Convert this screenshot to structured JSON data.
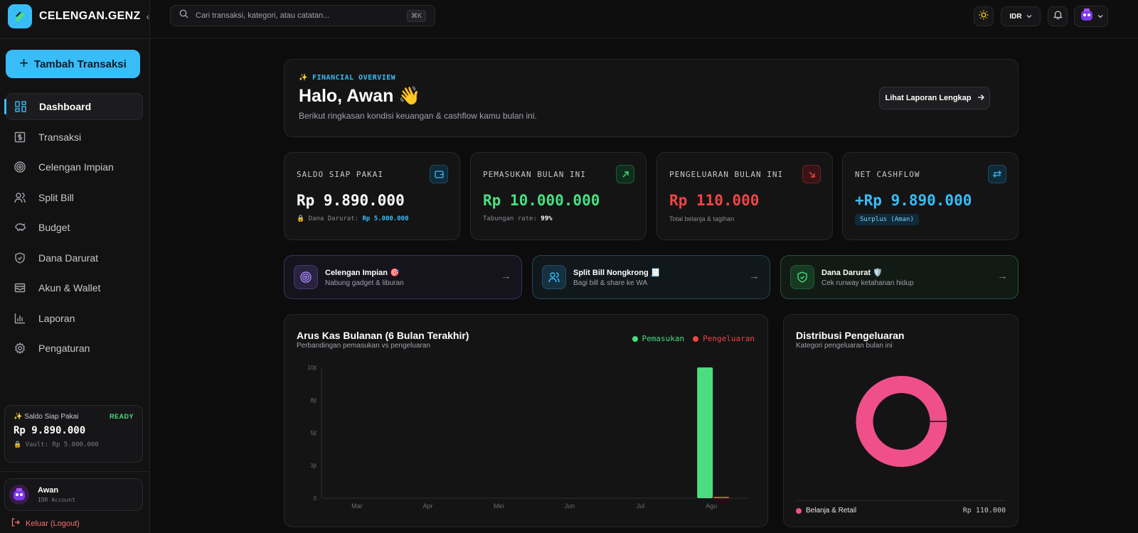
{
  "brand": {
    "name": "CELENGAN.GENZ"
  },
  "sidebar": {
    "add_button": "Tambah Transaksi",
    "items": [
      {
        "label": "Dashboard"
      },
      {
        "label": "Transaksi"
      },
      {
        "label": "Celengan Impian"
      },
      {
        "label": "Split Bill"
      },
      {
        "label": "Budget"
      },
      {
        "label": "Dana Darurat"
      },
      {
        "label": "Akun & Wallet"
      },
      {
        "label": "Laporan"
      },
      {
        "label": "Pengaturan"
      }
    ],
    "balance_card": {
      "title": "Saldo Siap Pakai",
      "status": "READY",
      "amount": "Rp 9.890.000",
      "vault": "Vault: Rp 5.000.000"
    },
    "user": {
      "name": "Awan",
      "account": "IDR Account"
    },
    "logout": "Keluar (Logout)"
  },
  "topbar": {
    "search_placeholder": "Cari transaksi, kategori, atau catatan...",
    "shortcut": "⌘K",
    "currency": "IDR"
  },
  "hero": {
    "tag": "FINANCIAL OVERVIEW",
    "greeting": "Halo, Awan 👋",
    "subtitle": "Berikut ringkasan kondisi keuangan & cashflow kamu bulan ini.",
    "report_button": "Lihat Laporan Lengkap"
  },
  "stats": {
    "saldo": {
      "label": "SALDO SIAP PAKAI",
      "value": "Rp 9.890.000",
      "foot_label": "Dana Darurat:",
      "foot_value": "Rp 5.000.000"
    },
    "pemasukan": {
      "label": "PEMASUKAN BULAN INI",
      "value": "Rp 10.000.000",
      "foot_label": "Tabungan rate:",
      "foot_value": "99%"
    },
    "pengeluaran": {
      "label": "PENGELUARAN BULAN INI",
      "value": "Rp 110.000",
      "foot": "Total belanja & tagihan"
    },
    "net": {
      "label": "NET CASHFLOW",
      "value": "+Rp 9.890.000",
      "badge": "Surplus (Aman)"
    }
  },
  "quick_actions": [
    {
      "title": "Celengan Impian 🎯",
      "subtitle": "Nabung gadget & liburan"
    },
    {
      "title": "Split Bill Nongkrong 🧾",
      "subtitle": "Bagi bill & share ke WA"
    },
    {
      "title": "Dana Darurat 🛡️",
      "subtitle": "Cek runway ketahanan hidup"
    }
  ],
  "colors": {
    "accent": "#38bdf8",
    "income": "#4ade80",
    "expense": "#ef4444",
    "pink": "#f0508a"
  },
  "chart_data": [
    {
      "type": "bar",
      "title": "Arus Kas Bulanan (6 Bulan Terakhir)",
      "subtitle": "Perbandingan pemasukan vs pengeluaran",
      "categories": [
        "Mar",
        "Apr",
        "Mei",
        "Jun",
        "Jul",
        "Agu"
      ],
      "series": [
        {
          "name": "Pemasukan",
          "values": [
            0,
            0,
            0,
            0,
            0,
            10000000
          ],
          "color": "#4ade80"
        },
        {
          "name": "Pengeluaran",
          "values": [
            0,
            0,
            0,
            0,
            0,
            110000
          ],
          "color": "#ef4444"
        }
      ],
      "yticks": [
        0,
        2500000,
        5000000,
        7500000,
        10000000
      ],
      "ytick_labels": [
        "0",
        "3jt",
        "5jt",
        "8jt",
        "10jt"
      ],
      "ylim": [
        0,
        10000000
      ],
      "legend": "top-right"
    },
    {
      "type": "pie",
      "title": "Distribusi Pengeluaran",
      "subtitle": "Kategori pengeluaran bulan ini",
      "labels": [
        "Belanja & Retail"
      ],
      "values": [
        110000
      ],
      "value_labels": [
        "Rp 110.000"
      ],
      "colors": [
        "#f0508a"
      ]
    }
  ]
}
